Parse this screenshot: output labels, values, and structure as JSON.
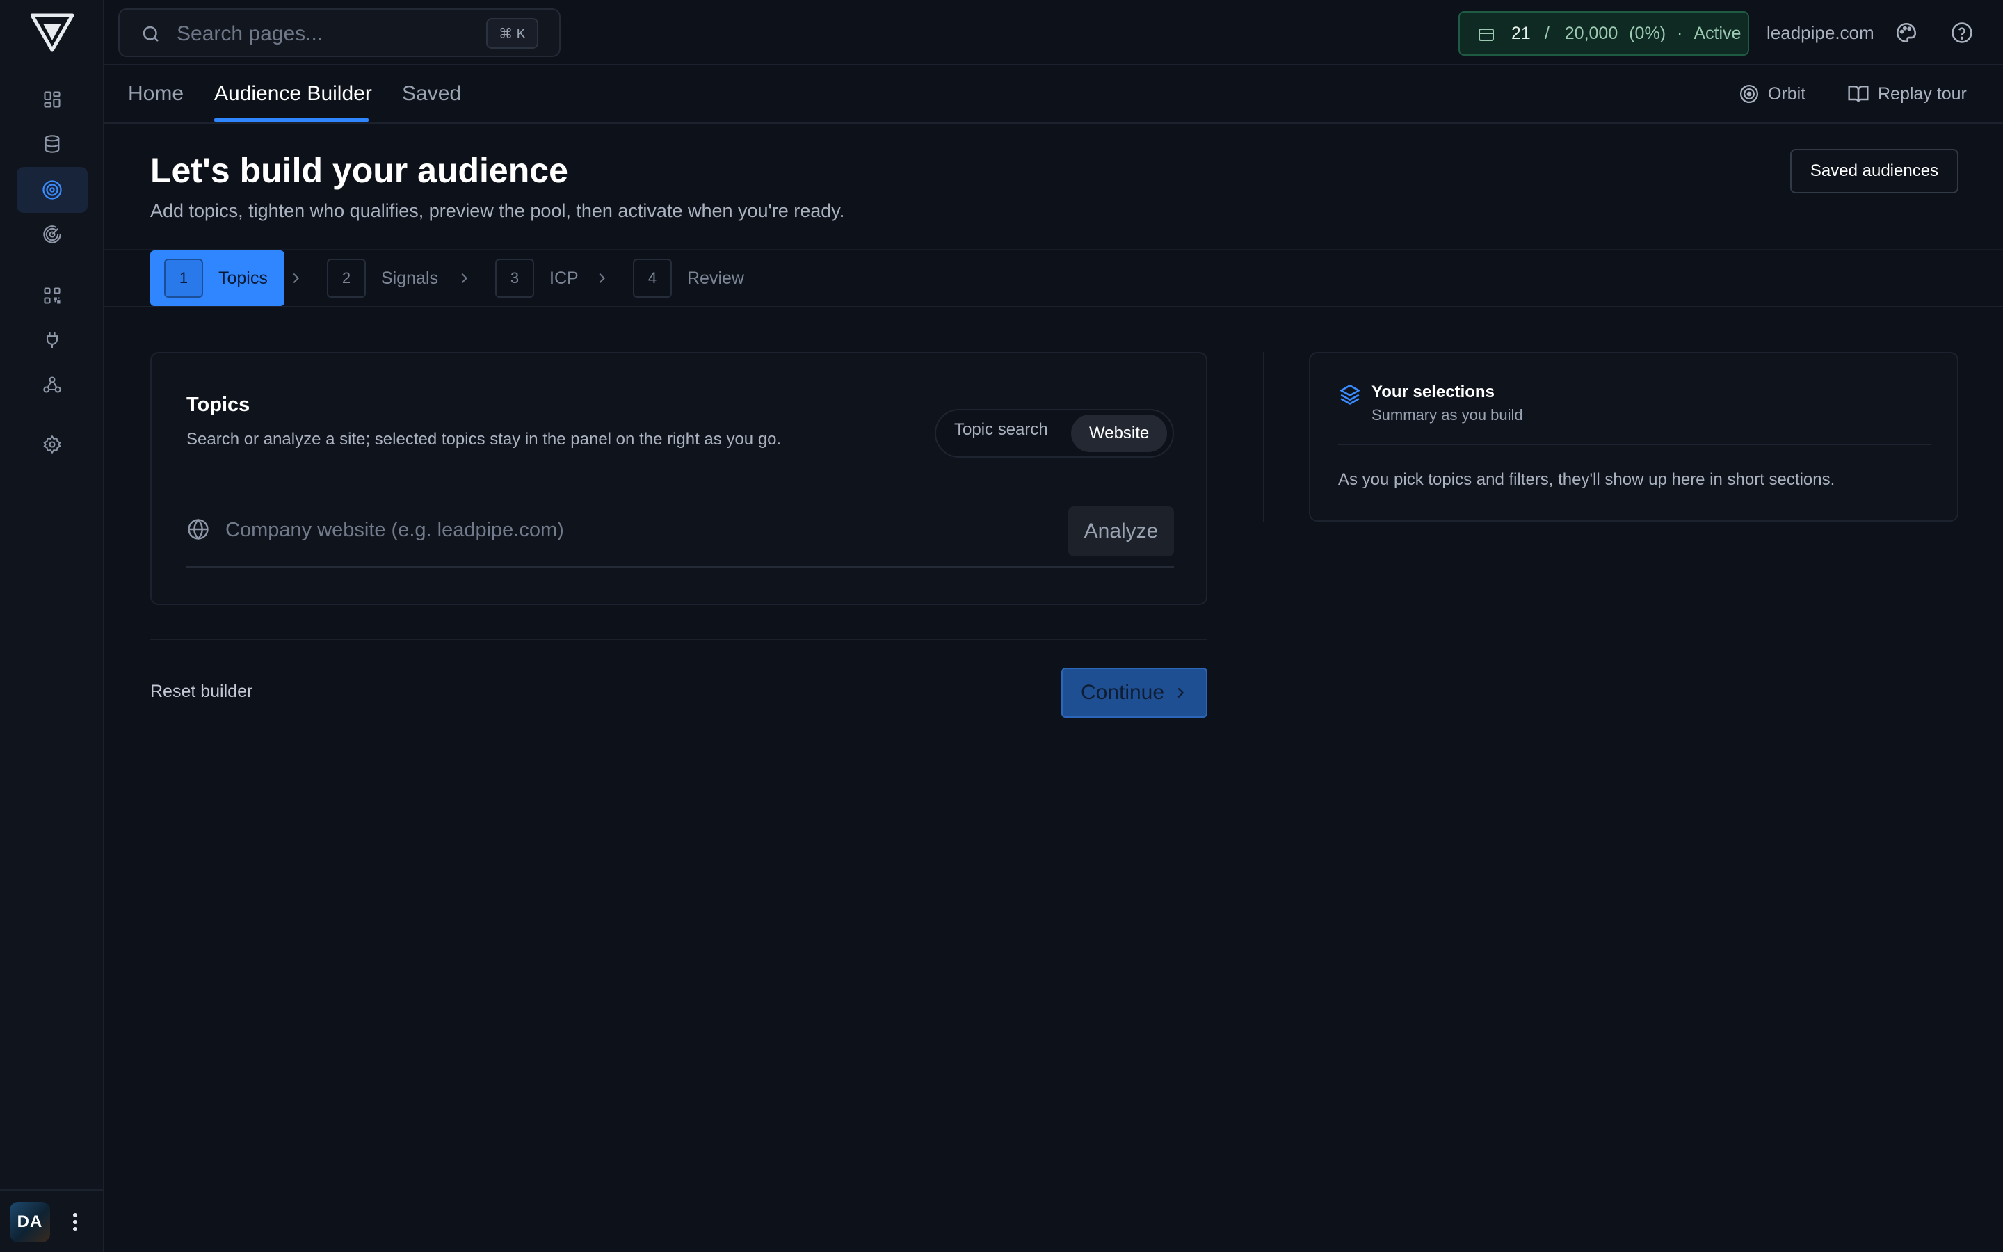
{
  "app": {
    "logo_name": "logo"
  },
  "search": {
    "placeholder": "Search pages...",
    "shortcut": "⌘ K"
  },
  "credits": {
    "used": "21",
    "separator": "/",
    "total": "20,000",
    "percent": "(0%)",
    "dot": "·",
    "status": "Active"
  },
  "account": {
    "domain": "leadpipe.com"
  },
  "sidebar": {
    "items": [
      {
        "icon": "dashboard-icon"
      },
      {
        "icon": "database-icon"
      },
      {
        "icon": "target-icon",
        "active": true
      },
      {
        "icon": "radar-icon"
      },
      {
        "icon": "qr-grid-icon"
      },
      {
        "icon": "plug-icon"
      },
      {
        "icon": "webhook-icon"
      },
      {
        "icon": "gear-icon"
      }
    ],
    "user_initials": "DA"
  },
  "tabs": [
    {
      "label": "Home"
    },
    {
      "label": "Audience Builder",
      "active": true
    },
    {
      "label": "Saved"
    }
  ],
  "tab_actions": {
    "orbit": "Orbit",
    "replay": "Replay tour"
  },
  "header": {
    "title": "Let's build your audience",
    "subtitle": "Add topics, tighten who qualifies, preview the pool, then activate when you're ready.",
    "saved_button": "Saved audiences"
  },
  "steps": [
    {
      "num": "1",
      "label": "Topics",
      "active": true
    },
    {
      "num": "2",
      "label": "Signals"
    },
    {
      "num": "3",
      "label": "ICP"
    },
    {
      "num": "4",
      "label": "Review"
    }
  ],
  "topics_card": {
    "title": "Topics",
    "subtitle": "Search or analyze a site; selected topics stay in the panel on the right as you go.",
    "modes": [
      "Topic search",
      "Website"
    ],
    "selected_mode": "Website",
    "url_placeholder": "Company website (e.g. leadpipe.com)",
    "analyze_label": "Analyze"
  },
  "selections": {
    "title": "Your selections",
    "subtitle": "Summary as you build",
    "empty_text": "As you pick topics and filters, they'll show up here in short sections."
  },
  "footer": {
    "reset_label": "Reset builder",
    "continue_label": "Continue"
  },
  "colors": {
    "accent": "#2f86ff",
    "active_status": "#1f5a43",
    "background": "#0d111a"
  }
}
